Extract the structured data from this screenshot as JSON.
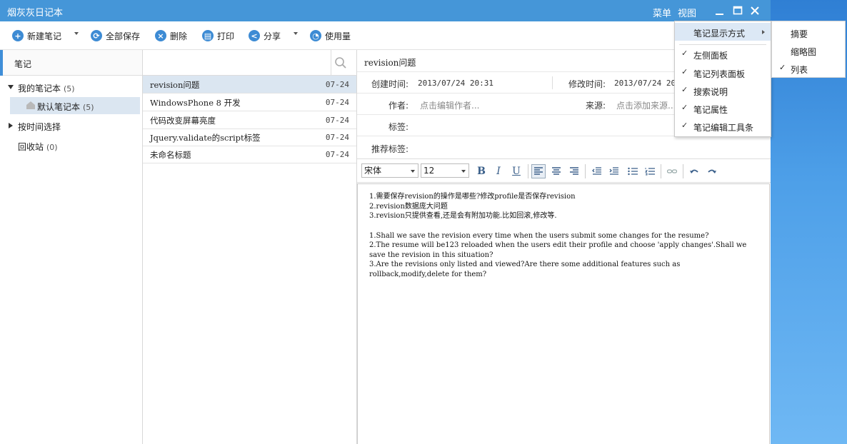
{
  "app": {
    "title": "烟灰灰日记本",
    "menu_label": "菜单",
    "view_label": "视图"
  },
  "toolbar": {
    "new_note": "新建笔记",
    "save_all": "全部保存",
    "delete": "删除",
    "print": "打印",
    "share": "分享",
    "usage": "使用量"
  },
  "sidebar": {
    "header": "笔记",
    "items": [
      {
        "label": "我的笔记本",
        "count": "(5)"
      },
      {
        "label": "默认笔记本",
        "count": "(5)"
      },
      {
        "label": "按时间选择",
        "count": ""
      },
      {
        "label": "回收站",
        "count": "(0)"
      }
    ]
  },
  "search": {
    "placeholder": "",
    "value": ""
  },
  "notes": [
    {
      "title": "revision问题",
      "date": "07-24"
    },
    {
      "title": "WindowsPhone 8 开发",
      "date": "07-24"
    },
    {
      "title": "代码改变屏幕亮度",
      "date": "07-24"
    },
    {
      "title": "Jquery.validate的script标签",
      "date": "07-24"
    },
    {
      "title": "未命名标题",
      "date": "07-24"
    }
  ],
  "editor": {
    "title": "revision问题",
    "created_label": "创建时间:",
    "created_value": "2013/07/24 20:31",
    "modified_label": "修改时间:",
    "modified_value": "2013/07/24 20:",
    "author_label": "作者:",
    "author_placeholder": "点击编辑作者...",
    "source_label": "来源:",
    "source_placeholder": "点击添加来源...",
    "tags_label": "标签:",
    "rec_tags_label": "推荐标签:",
    "font_family": "宋体",
    "font_size": "12",
    "content": [
      "1.需要保存revision的操作是哪些?修改profile是否保存revision",
      "2.revision数据庞大问题",
      "3.revision只提供查看,还是会有附加功能.比如回滚,修改等.",
      "",
      "1.Shall we save the revision every time when the users submit some changes for the resume?",
      "2.The resume will be123 reloaded when the users edit their profile and choose 'apply changes'.Shall we save the revision in this situation?",
      "3.Are the revisions only listed and viewed?Are there some additional features such as rollback,modify,delete for them?"
    ]
  },
  "view_menu": {
    "display_mode": "笔记显示方式",
    "items": [
      {
        "label": "左侧面板",
        "checked": "✓"
      },
      {
        "label": "笔记列表面板",
        "checked": "✓"
      },
      {
        "label": "搜索说明",
        "checked": "✓"
      },
      {
        "label": "笔记属性",
        "checked": "✓"
      },
      {
        "label": "笔记编辑工具条",
        "checked": "✓"
      }
    ],
    "sub_items": [
      {
        "label": "摘要",
        "checked": ""
      },
      {
        "label": "缩略图",
        "checked": ""
      },
      {
        "label": "列表",
        "checked": "✓"
      }
    ]
  }
}
